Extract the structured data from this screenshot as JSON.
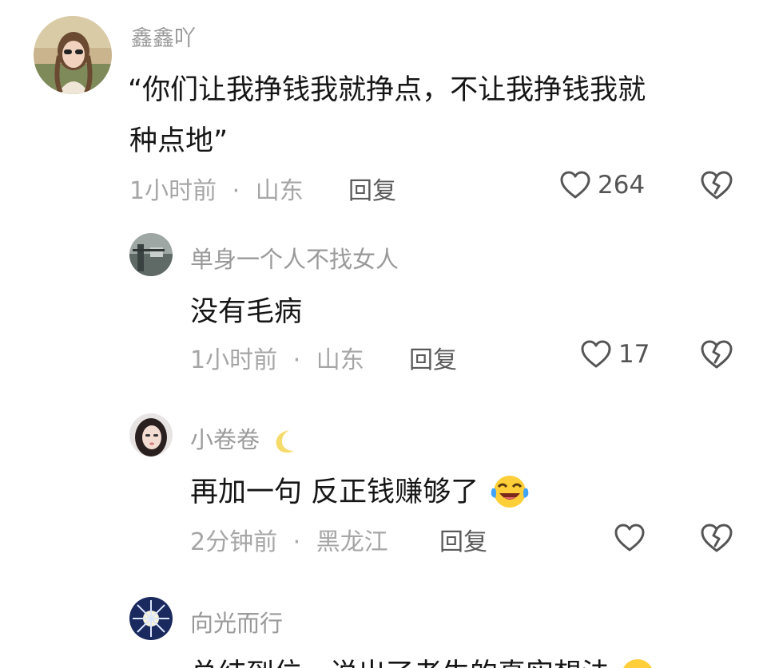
{
  "comments": [
    {
      "username": "鑫鑫吖",
      "text_lines": [
        "“你们让我挣钱我就挣点，不让我挣钱我就",
        "种点地”"
      ],
      "time": "1小时前",
      "separator": "·",
      "location": "山东",
      "reply_label": "回复",
      "likes": "264"
    },
    {
      "username": "单身一个人不找女人",
      "text": "没有毛病",
      "time": "1小时前",
      "separator": "·",
      "location": "山东",
      "reply_label": "回复",
      "likes": "17"
    },
    {
      "username": "小卷卷",
      "username_emoji": "crescent-moon-emoji",
      "text": "再加一句 反正钱赚够了",
      "text_emoji": "laughing-crying-emoji",
      "time": "2分钟前",
      "separator": "·",
      "location": "黑龙江",
      "reply_label": "回复",
      "likes": ""
    },
    {
      "username": "向光而行",
      "text": "总结到位，说出了老生的真实想法",
      "text_emoji": "smiling-emoji"
    }
  ],
  "colors": {
    "username": "#9a9a9a",
    "text": "#161616",
    "meta": "#a6a6a6",
    "icon": "#555555"
  },
  "icons": {
    "like": "heart-outline-icon",
    "dislike": "broken-heart-icon"
  }
}
